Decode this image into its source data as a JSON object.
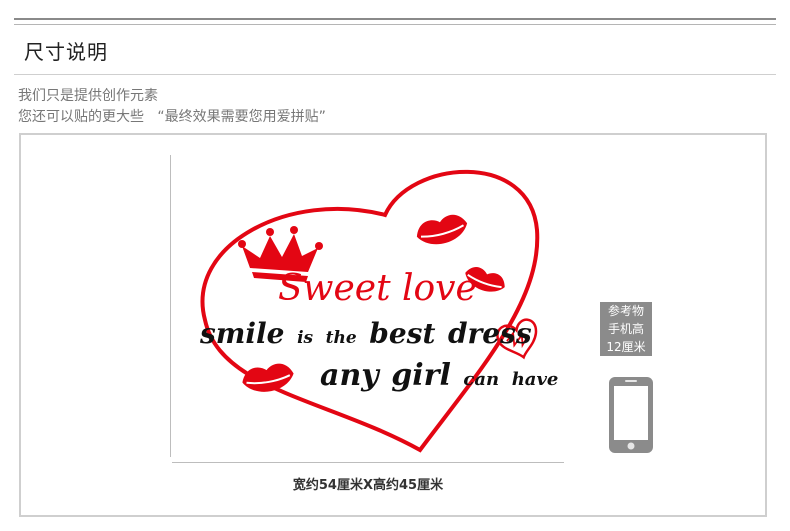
{
  "header": {
    "title": "尺寸说明"
  },
  "description": {
    "line1": "我们只是提供创作元素",
    "line2": "您还可以贴的更大些   “最终效果需要您用爱拼贴”"
  },
  "artwork": {
    "title": "Sweet love",
    "line2": {
      "w1": "smile",
      "w2": "is",
      "w3": "the",
      "w4": "best",
      "w5": "dress"
    },
    "line3": {
      "w1": "any",
      "w2": "girl",
      "w3": "can",
      "w4": "have"
    },
    "colors": {
      "red": "#e30613",
      "black": "#111111"
    },
    "icons": [
      "heart-outline",
      "crown",
      "lips",
      "small-heart"
    ]
  },
  "dimensions": {
    "caption": "宽约54厘米X高约45厘米"
  },
  "reference": {
    "line1": "参考物",
    "line2": "手机高",
    "line3": "12厘米",
    "icon": "phone-icon"
  }
}
